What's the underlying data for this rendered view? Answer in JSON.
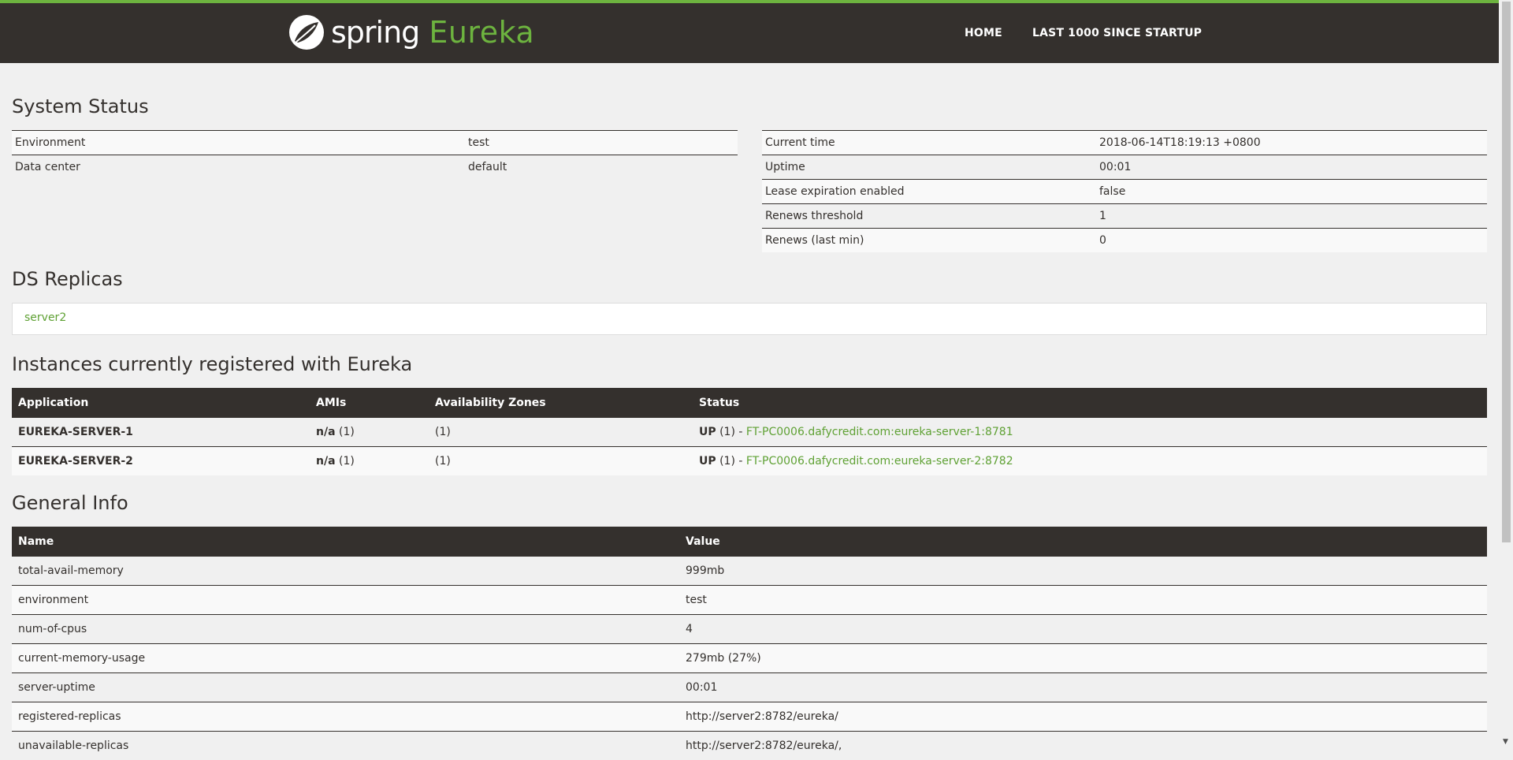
{
  "nav": {
    "logo_spring": "spring",
    "logo_eureka": "Eureka",
    "home": "HOME",
    "last1000": "LAST 1000 SINCE STARTUP"
  },
  "system_status": {
    "title": "System Status",
    "left": [
      {
        "label": "Environment",
        "value": "test"
      },
      {
        "label": "Data center",
        "value": "default"
      }
    ],
    "right": [
      {
        "label": "Current time",
        "value": "2018-06-14T18:19:13 +0800"
      },
      {
        "label": "Uptime",
        "value": "00:01"
      },
      {
        "label": "Lease expiration enabled",
        "value": "false"
      },
      {
        "label": "Renews threshold",
        "value": "1"
      },
      {
        "label": "Renews (last min)",
        "value": "0"
      }
    ]
  },
  "ds_replicas": {
    "title": "DS Replicas",
    "items": [
      "server2"
    ]
  },
  "instances": {
    "title": "Instances currently registered with Eureka",
    "headers": [
      "Application",
      "AMIs",
      "Availability Zones",
      "Status"
    ],
    "rows": [
      {
        "application": "EUREKA-SERVER-1",
        "ami": "n/a",
        "ami_count": "(1)",
        "zones": "(1)",
        "status": "UP",
        "status_count": "(1) -",
        "instance": "FT-PC0006.dafycredit.com:eureka-server-1:8781"
      },
      {
        "application": "EUREKA-SERVER-2",
        "ami": "n/a",
        "ami_count": "(1)",
        "zones": "(1)",
        "status": "UP",
        "status_count": "(1) -",
        "instance": "FT-PC0006.dafycredit.com:eureka-server-2:8782"
      }
    ]
  },
  "general_info": {
    "title": "General Info",
    "headers": [
      "Name",
      "Value"
    ],
    "rows": [
      {
        "name": "total-avail-memory",
        "value": "999mb"
      },
      {
        "name": "environment",
        "value": "test"
      },
      {
        "name": "num-of-cpus",
        "value": "4"
      },
      {
        "name": "current-memory-usage",
        "value": "279mb (27%)"
      },
      {
        "name": "server-uptime",
        "value": "00:01"
      },
      {
        "name": "registered-replicas",
        "value": "http://server2:8782/eureka/"
      },
      {
        "name": "unavailable-replicas",
        "value": "http://server2:8782/eureka/,"
      }
    ]
  },
  "colors": {
    "nav_bg": "#34302d",
    "accent": "#6db33f",
    "link": "#5fa134",
    "page_bg": "#f0f0f0"
  },
  "icons": {
    "logo": "spring-leaf-icon",
    "scroll_down": "arrow-down-icon"
  }
}
